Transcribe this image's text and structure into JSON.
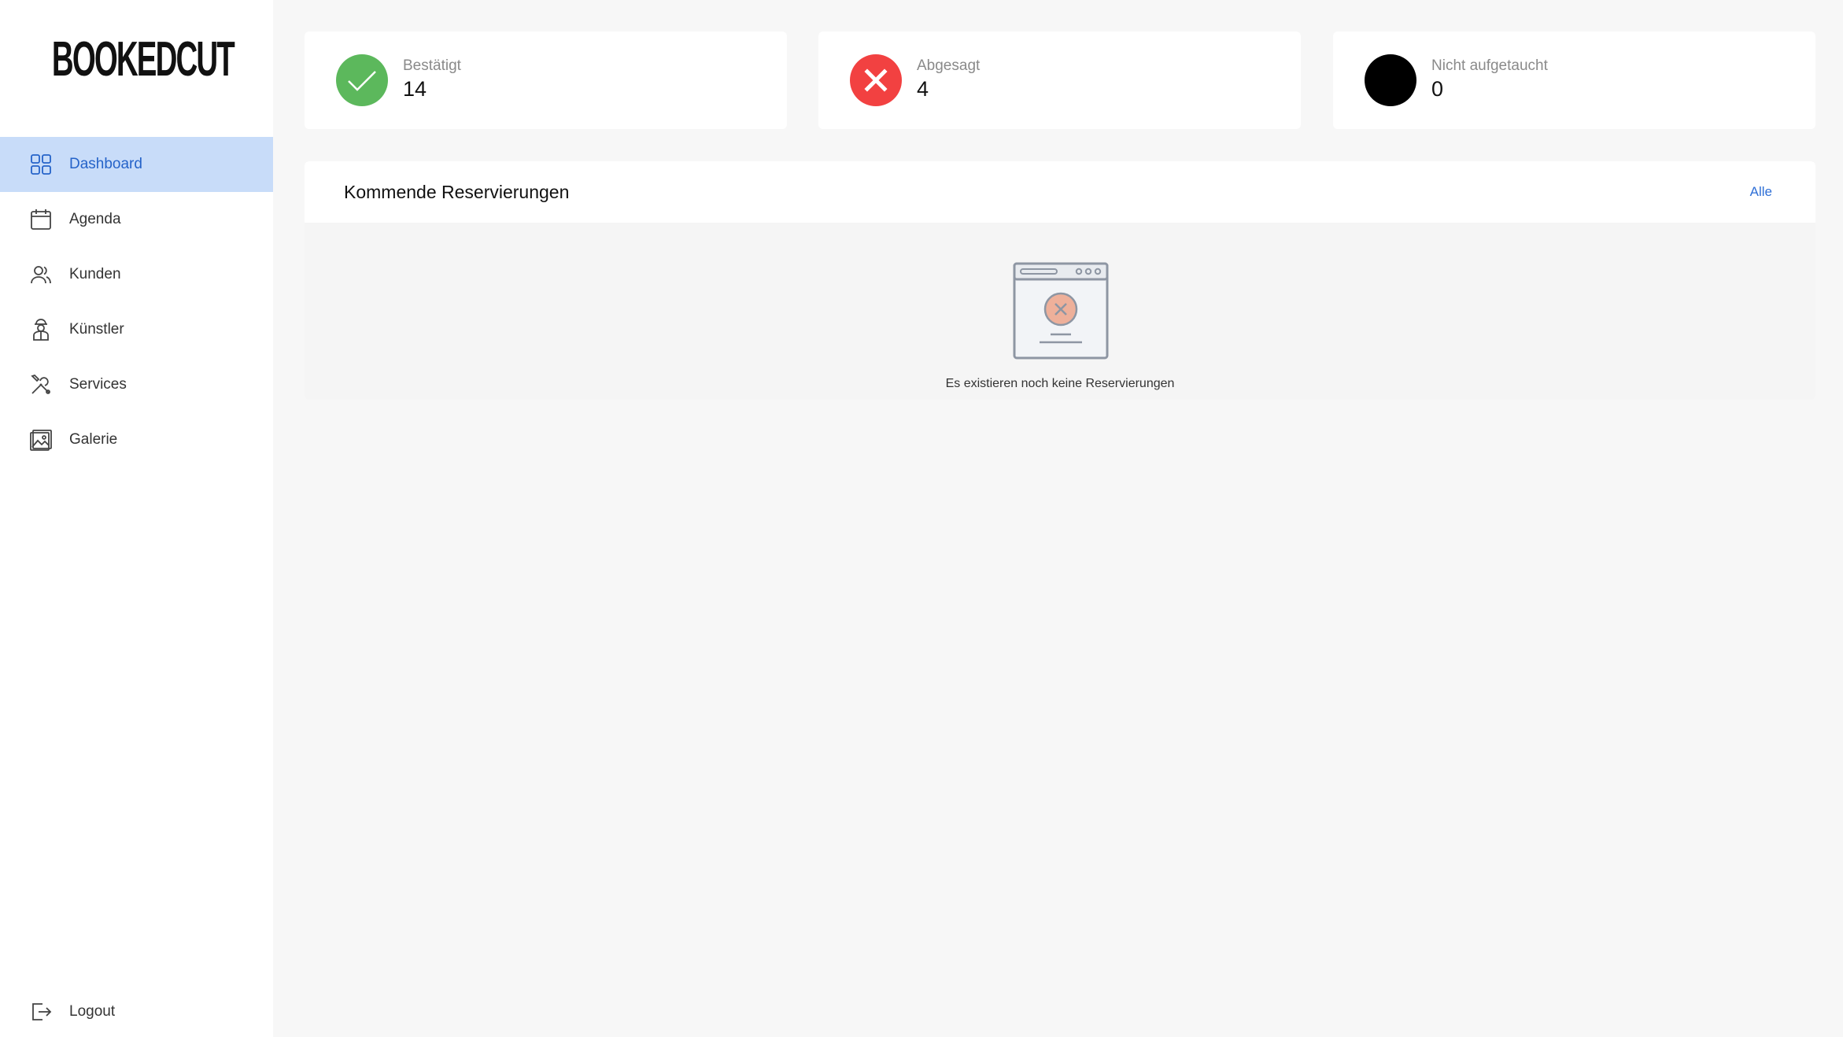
{
  "brand": {
    "logo_text": "BOOKEDCUT"
  },
  "sidebar": {
    "items": [
      {
        "label": "Dashboard",
        "icon": "grid-icon",
        "active": true
      },
      {
        "label": "Agenda",
        "icon": "calendar-icon",
        "active": false
      },
      {
        "label": "Kunden",
        "icon": "users-icon",
        "active": false
      },
      {
        "label": "Künstler",
        "icon": "artist-icon",
        "active": false
      },
      {
        "label": "Services",
        "icon": "tools-icon",
        "active": false
      },
      {
        "label": "Galerie",
        "icon": "image-icon",
        "active": false
      }
    ],
    "logout": {
      "label": "Logout",
      "icon": "logout-icon"
    }
  },
  "stats": [
    {
      "label": "Bestätigt",
      "value": "14",
      "color": "#5cb85c",
      "icon": "check-icon"
    },
    {
      "label": "Abgesagt",
      "value": "4",
      "color": "#f24141",
      "icon": "x-icon"
    },
    {
      "label": "Nicht aufgetaucht",
      "value": "0",
      "color": "#000000",
      "icon": "dot-icon"
    }
  ],
  "reservations": {
    "title": "Kommende Reservierungen",
    "link_label": "Alle",
    "empty_text": "Es existieren noch keine Reservierungen"
  },
  "colors": {
    "accent": "#2563c9",
    "active_bg": "#c8dcf9"
  }
}
